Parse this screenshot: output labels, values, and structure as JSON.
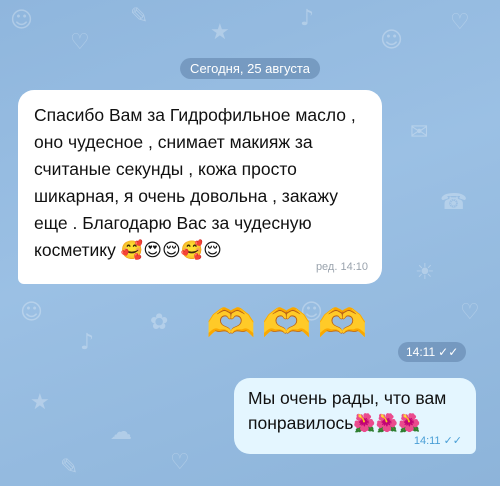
{
  "date_separator": "Сегодня, 25 августа",
  "incoming_message": {
    "text": "Спасибо Вам за Гидрофильное масло , оно чудесное , снимает макияж за считаные секунды , кожа просто шикарная, я очень довольна , закажу еще . Благодарю Вас за чудесную косметику",
    "emojis": "🥰😍😌🥰😌",
    "edited_label": "ред.",
    "time": "14:10"
  },
  "sticker_message": {
    "emojis": "🫶🫶🫶",
    "time": "14:11",
    "check_icon": "double-check-icon"
  },
  "outgoing_message": {
    "text": "Мы очень рады, что вам понравилось",
    "emojis": "🌺🌺🌺",
    "time": "14:11",
    "check_icon": "double-check-icon"
  },
  "colors": {
    "wallpaper": "#9bc0e4",
    "incoming_bubble": "#ffffff",
    "outgoing_bubble": "#e4f6ff",
    "read_check": "#4a9fd6"
  }
}
